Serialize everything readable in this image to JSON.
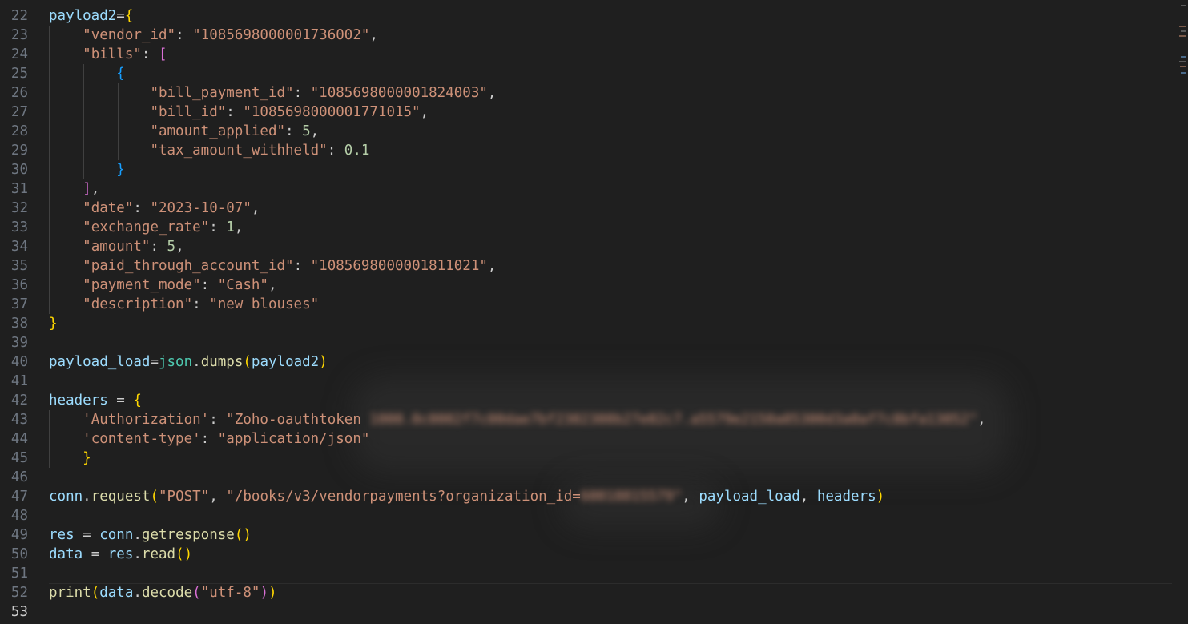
{
  "colors": {
    "background": "#1f1f1f",
    "line_number": "#6e7681",
    "string": "#ce9178",
    "variable": "#9cdcfe",
    "function": "#dcdcaa",
    "number": "#b5cea8",
    "bracket_level1": "#ffd700",
    "bracket_level2": "#da70d6",
    "bracket_level3": "#179fff"
  },
  "editor": {
    "current_line": "53",
    "line_numbers": [
      "22",
      "23",
      "24",
      "25",
      "26",
      "27",
      "28",
      "29",
      "30",
      "31",
      "32",
      "33",
      "34",
      "35",
      "36",
      "37",
      "38",
      "39",
      "40",
      "41",
      "42",
      "43",
      "44",
      "45",
      "46",
      "47",
      "48",
      "49",
      "50",
      "51",
      "52",
      "53"
    ],
    "code": {
      "l23_var": "payload2",
      "l23_op": "=",
      "l23_brace": "{",
      "l24_key": "\"vendor_id\"",
      "l24_val": "\"1085698000001736002\"",
      "l25_key": "\"bills\"",
      "l25_br": "[",
      "l26_br": "{",
      "l27_key": "\"bill_payment_id\"",
      "l27_val": "\"1085698000001824003\"",
      "l28_key": "\"bill_id\"",
      "l28_val": "\"1085698000001771015\"",
      "l29_key": "\"amount_applied\"",
      "l29_val": "5",
      "l30_key": "\"tax_amount_withheld\"",
      "l30_val": "0.1",
      "l31_br": "}",
      "l32_br": "]",
      "l33_key": "\"date\"",
      "l33_val": "\"2023-10-07\"",
      "l34_key": "\"exchange_rate\"",
      "l34_val": "1",
      "l35_key": "\"amount\"",
      "l35_val": "5",
      "l36_key": "\"paid_through_account_id\"",
      "l36_val": "\"1085698000001811021\"",
      "l37_key": "\"payment_mode\"",
      "l37_val": "\"Cash\"",
      "l38_key": "\"description\"",
      "l38_val": "\"new blouses\"",
      "l39_brace": "}",
      "l41_var": "payload_load",
      "l41_op": "=",
      "l41_mod": "json",
      "l41_func": "dumps",
      "l41_open": "(",
      "l41_arg": "payload2",
      "l41_close": ")",
      "l43_var": "headers",
      "l43_op": " = ",
      "l43_brace": "{",
      "l44_key": "'Authorization'",
      "l44_val_visible": "\"Zoho-oauthtoken ",
      "l44_val_blurred": "1000.0c0002f7c00dae7bf2302308b27e02c7.a5579e2150a85300d3a0af7c8bfa13052\"",
      "l45_key": "'content-type'",
      "l45_val": "\"application/json\"",
      "l46_brace": "}",
      "l48_obj": "conn",
      "l48_func": "request",
      "l48_open": "(",
      "l48_arg1": "\"POST\"",
      "l48_arg2_visible": "\"/books/v3/vendorpayments?organization_id=",
      "l48_arg2_blurred": "60018815579\"",
      "l48_arg3": "payload_load",
      "l48_arg4": "headers",
      "l48_close": ")",
      "l50_var": "res",
      "l50_op": " = ",
      "l50_obj": "conn",
      "l50_func": "getresponse",
      "l50_parens": "()",
      "l51_var": "data",
      "l51_op": " = ",
      "l51_obj": "res",
      "l51_func": "read",
      "l51_parens": "()",
      "l53_func": "print",
      "l53_open": "(",
      "l53_obj": "data",
      "l53_method": "decode",
      "l53_open2": "(",
      "l53_arg": "\"utf-8\"",
      "l53_close2": ")",
      "l53_close": ")"
    }
  }
}
